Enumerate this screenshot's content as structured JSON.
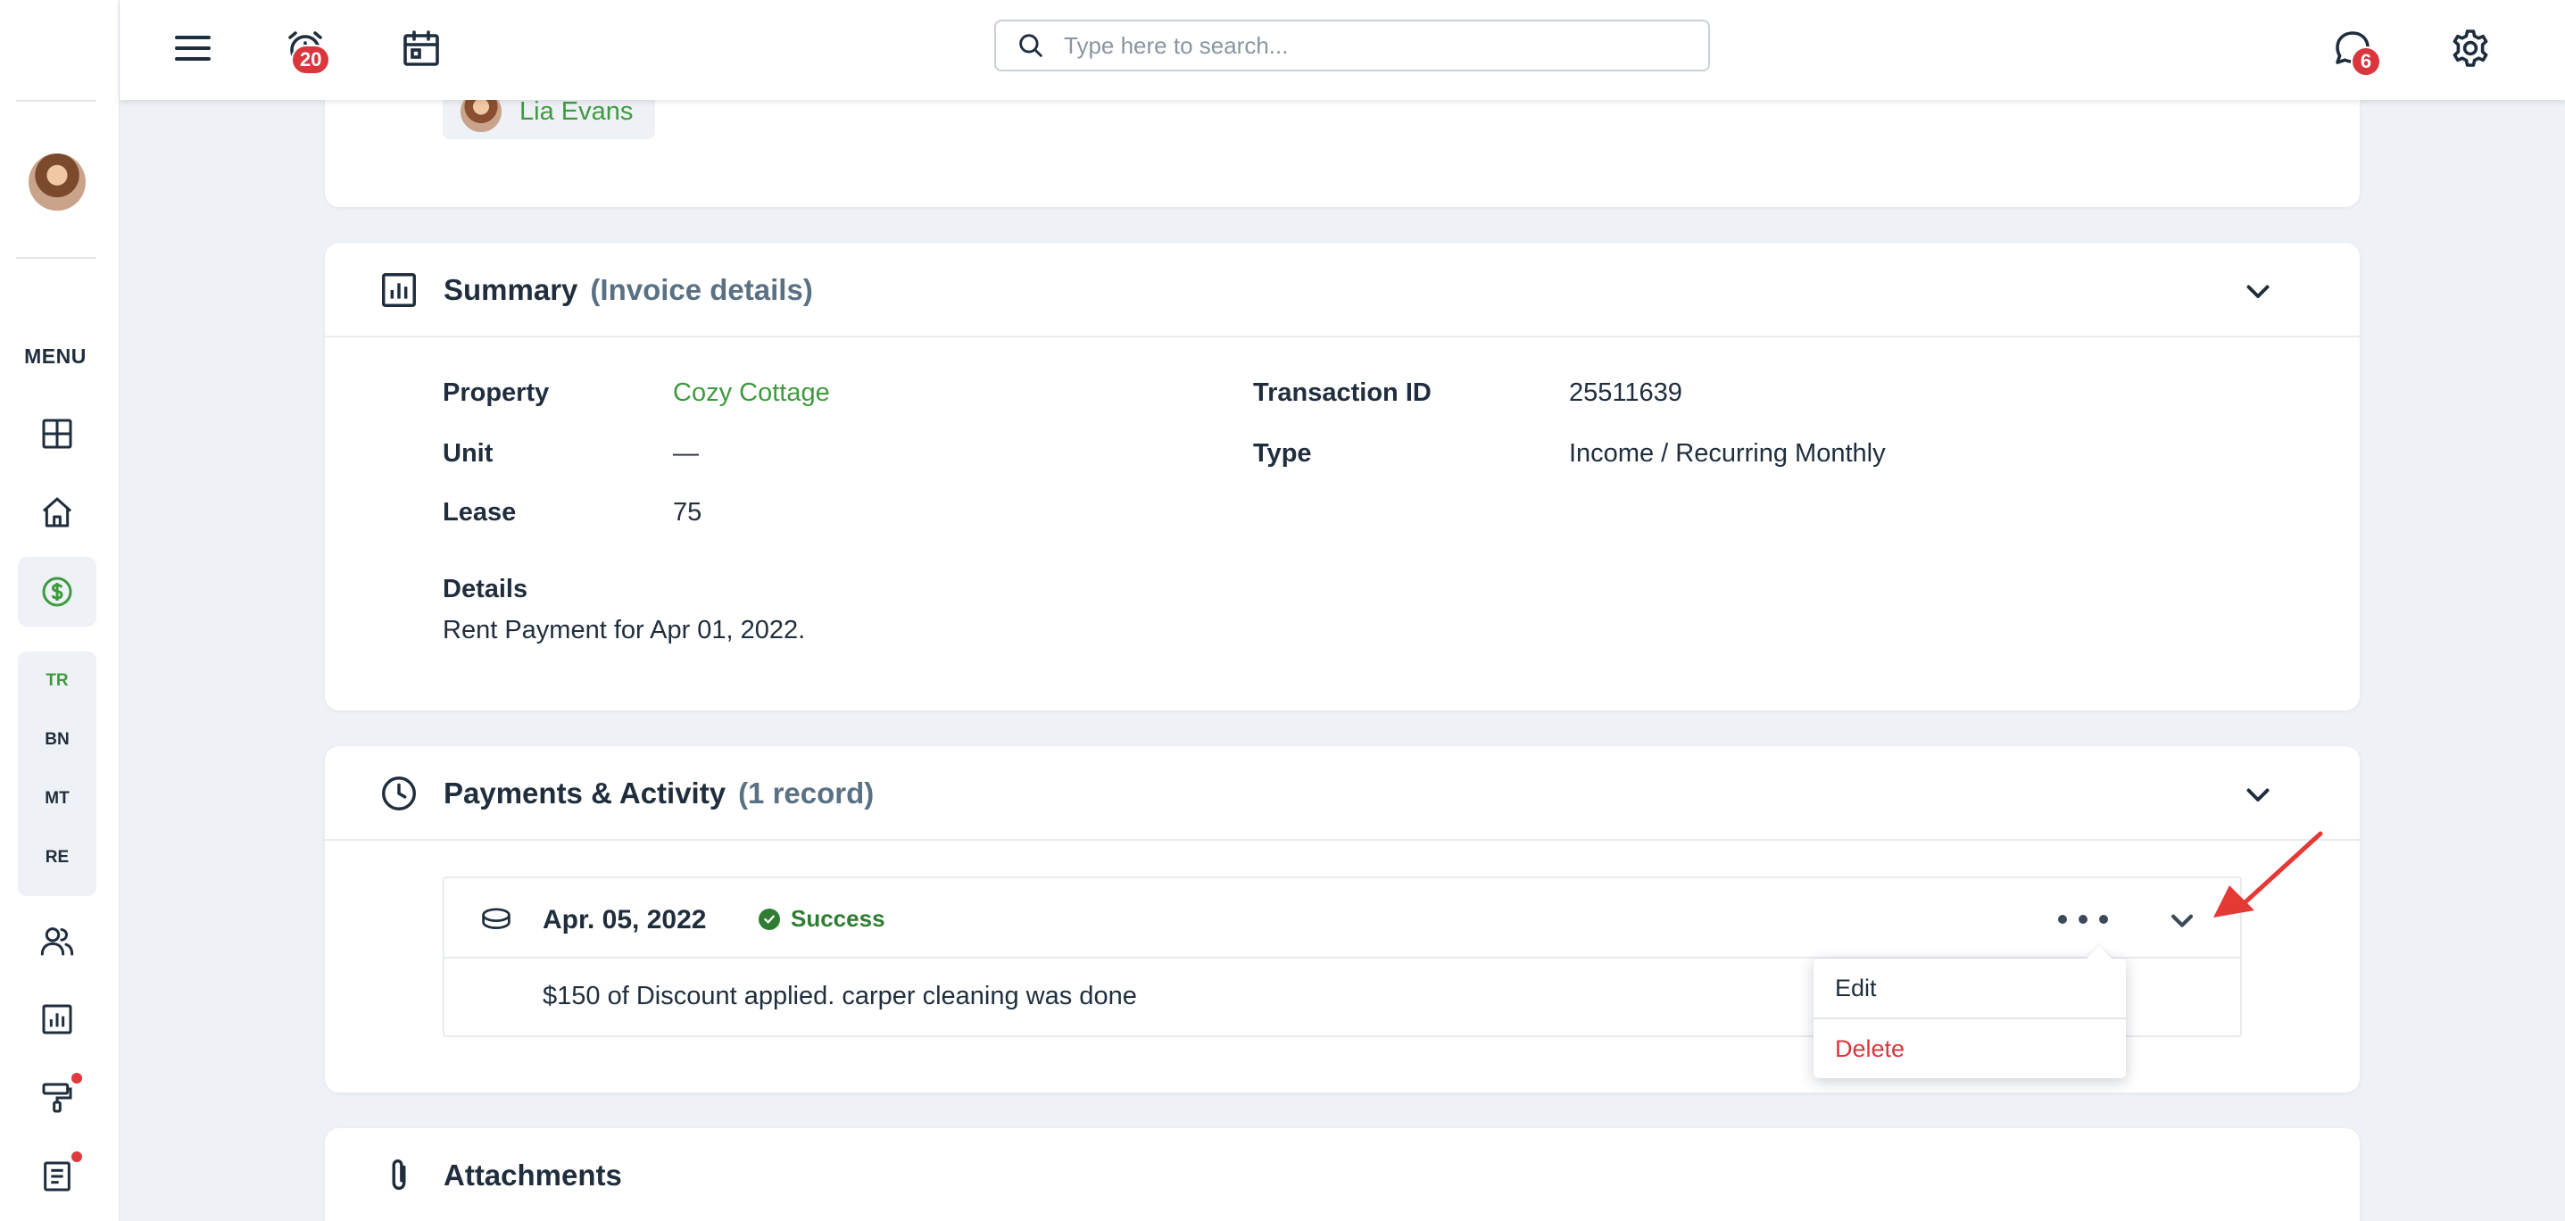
{
  "topbar": {
    "notifications_count": "20",
    "messages_count": "6",
    "search_placeholder": "Type here to search..."
  },
  "sidebar": {
    "menu_label": "MENU",
    "accounting_items": [
      {
        "label": "TR",
        "active": true
      },
      {
        "label": "BN",
        "active": false
      },
      {
        "label": "MT",
        "active": false
      },
      {
        "label": "RE",
        "active": false
      }
    ]
  },
  "owner": {
    "name": "Lia Evans"
  },
  "summary": {
    "title": "Summary",
    "subtitle": "(Invoice details)",
    "property_label": "Property",
    "property_value": "Cozy Cottage",
    "unit_label": "Unit",
    "unit_value": "—",
    "lease_label": "Lease",
    "lease_value": "75",
    "transaction_id_label": "Transaction ID",
    "transaction_id_value": "25511639",
    "type_label": "Type",
    "type_value": "Income / Recurring Monthly",
    "details_label": "Details",
    "details_value": "Rent Payment for Apr 01, 2022."
  },
  "payments": {
    "title": "Payments & Activity",
    "subtitle": "(1 record)",
    "record": {
      "date": "Apr. 05, 2022",
      "status": "Success",
      "note": "$150 of Discount applied. carper cleaning was done"
    },
    "menu": {
      "edit_label": "Edit",
      "delete_label": "Delete"
    }
  },
  "attachments": {
    "title": "Attachments"
  },
  "colors": {
    "accent_green": "#3f9a3f",
    "success_green": "#2e7d32",
    "danger_red": "#d9363e",
    "text_dark": "#1f2d3d",
    "background": "#eef1f5"
  }
}
